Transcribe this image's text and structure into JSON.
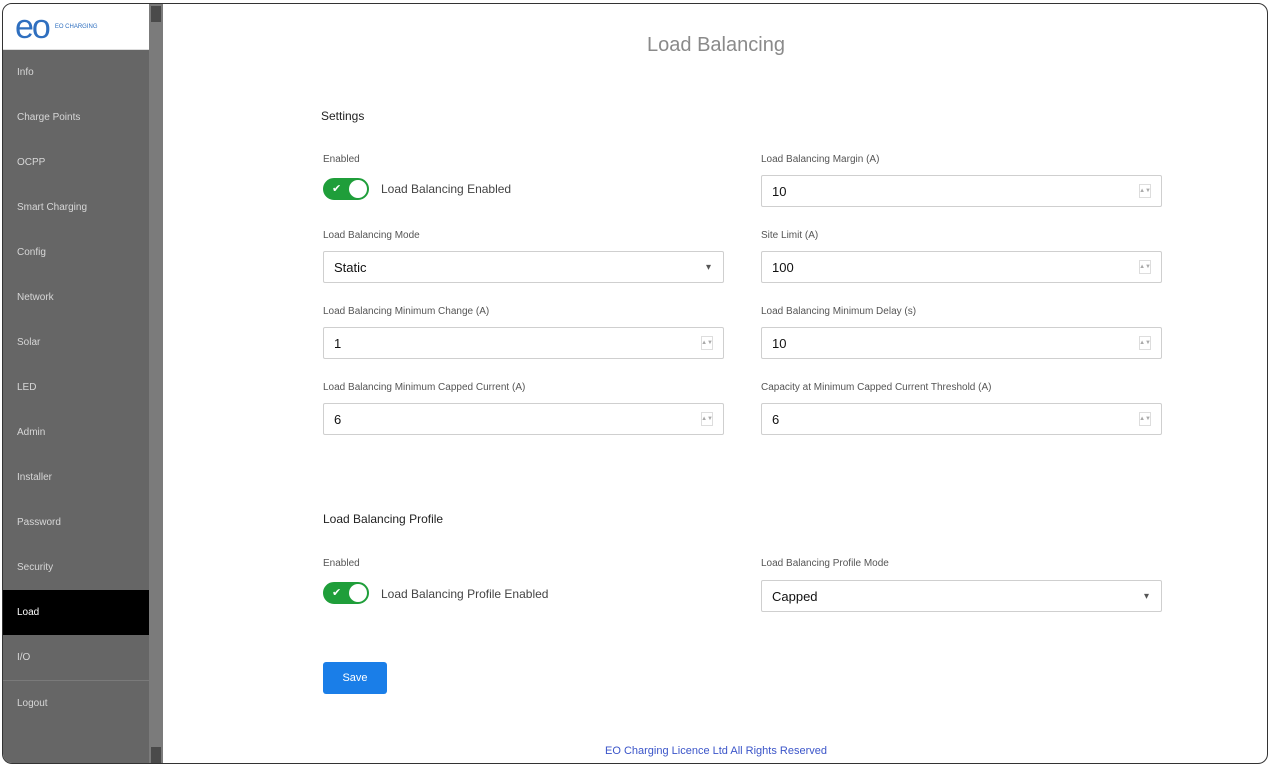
{
  "window": {
    "title": "Load Balancing"
  },
  "sidebar": {
    "logo_mark": "eo",
    "logo_text": "EO CHARGING",
    "items": [
      {
        "label": "Info"
      },
      {
        "label": "Charge Points"
      },
      {
        "label": "OCPP"
      },
      {
        "label": "Smart Charging"
      },
      {
        "label": "Config"
      },
      {
        "label": "Network"
      },
      {
        "label": "Solar"
      },
      {
        "label": "LED"
      },
      {
        "label": "Admin"
      },
      {
        "label": "Installer"
      },
      {
        "label": "Password"
      },
      {
        "label": "Security"
      },
      {
        "label": "Load"
      },
      {
        "label": "I/O"
      },
      {
        "label": "Logout"
      }
    ],
    "active_index": 12
  },
  "settings": {
    "section_title": "Settings",
    "enabled": {
      "label": "Enabled",
      "toggle_text": "Load Balancing Enabled",
      "state": true
    },
    "margin": {
      "label": "Load Balancing Margin (A)",
      "value": "10"
    },
    "mode": {
      "label": "Load Balancing Mode",
      "value": "Static"
    },
    "site_limit": {
      "label": "Site Limit (A)",
      "value": "100"
    },
    "min_change": {
      "label": "Load Balancing Minimum Change (A)",
      "value": "1"
    },
    "min_delay": {
      "label": "Load Balancing Minimum Delay (s)",
      "value": "10"
    },
    "min_current": {
      "label": "Load Balancing Minimum Capped Current (A)",
      "value": "6"
    },
    "cap_threshold": {
      "label": "Capacity at Minimum Capped Current Threshold (A)",
      "value": "6"
    }
  },
  "profile": {
    "section_title": "Load Balancing Profile",
    "enabled": {
      "label": "Enabled",
      "toggle_text": "Load Balancing Profile Enabled",
      "state": true
    },
    "mode": {
      "label": "Load Balancing Profile Mode",
      "value": "Capped"
    }
  },
  "save_label": "Save",
  "footer": "EO Charging Licence Ltd All Rights Reserved",
  "colors": {
    "sidebar_bg": "#666666",
    "active_bg": "#000000",
    "toggle_on": "#1f9e3a",
    "primary_button": "#1a7ee8",
    "footer_link": "#3b55c9"
  }
}
